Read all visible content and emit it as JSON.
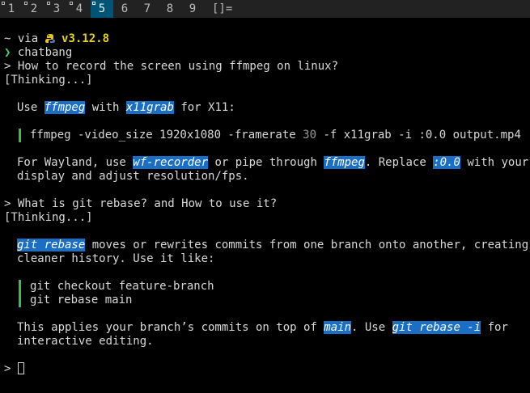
{
  "topbar": {
    "tags": [
      "1",
      "2",
      "3",
      "4",
      "5",
      "6",
      "7",
      "8",
      "9"
    ],
    "active_tag": "5",
    "occupied_tags": [
      "1",
      "2",
      "3",
      "4",
      "5"
    ],
    "layout_symbol": "[]="
  },
  "prompt": {
    "line1_prefix": "~ via ",
    "icon": "python-snake-icon",
    "version": "v3.12.8",
    "arrow": "❯ ",
    "command": "chatbang"
  },
  "session": {
    "q1": "> How to record the screen using ffmpeg on linux?",
    "thinking1": "[Thinking...]",
    "a1_p1": {
      "t1": "Use ",
      "c1": "ffmpeg",
      "t2": " with ",
      "c2": "x11grab",
      "t3": " for X11:"
    },
    "a1_code": {
      "part1": "ffmpeg -video_size 1920x1080 -framerate ",
      "num": "30",
      "part2": " -f x11grab -i :0.0 output.mp4"
    },
    "a1_p2": {
      "t1": "For Wayland, use ",
      "c1": "wf-recorder",
      "t2": " or pipe through ",
      "c2": "ffmpeg",
      "t3": ". Replace ",
      "c3": ":0.0",
      "t4": " with your",
      "line2": "display and adjust resolution/fps."
    },
    "q2": "> What is git rebase? and How to use it?",
    "thinking2": "[Thinking...]",
    "a2_p1": {
      "c1": "git rebase",
      "t1": " moves or rewrites commits from one branch onto another, creating a",
      "line2": "cleaner history. Use it like:"
    },
    "a2_code": {
      "line1": "git checkout feature-branch",
      "line2": "git rebase main"
    },
    "a2_p2": {
      "t1": "This applies your branch’s commits on top of ",
      "c1": "main",
      "t2": ". Use ",
      "c2": "git rebase -i",
      "t3": " for",
      "line2": "interactive editing."
    },
    "input_prompt": "> "
  },
  "colors": {
    "topbar_bg": "#222222",
    "active_tag_bg": "#005577",
    "highlight_bg": "#1a6fc4",
    "quote_bar": "#2ec34f",
    "version_color": "#e4d21b"
  }
}
